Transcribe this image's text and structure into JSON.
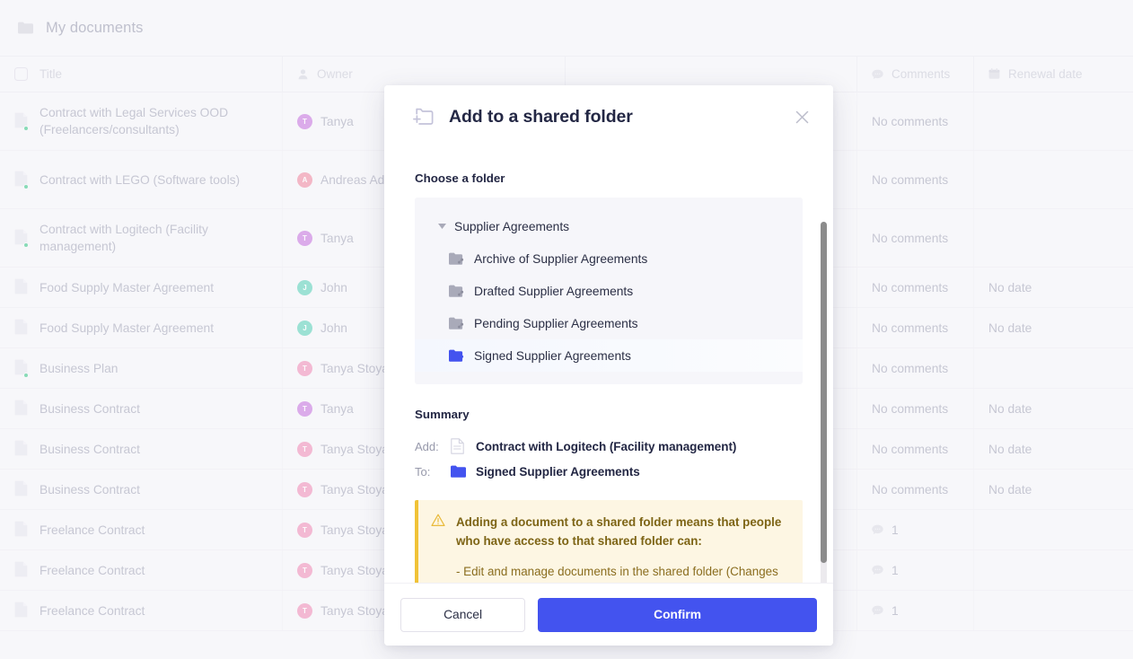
{
  "page": {
    "header": {
      "folder_icon": "folder-icon",
      "title": "My documents"
    },
    "table": {
      "columns": [
        {
          "key": "title",
          "label": "Title",
          "icon": "checkbox-icon"
        },
        {
          "key": "owner",
          "label": "Owner",
          "icon": "person-icon"
        },
        {
          "key": "mid",
          "label": "",
          "icon": ""
        },
        {
          "key": "comments",
          "label": "Comments",
          "icon": "comment-icon"
        },
        {
          "key": "renewal",
          "label": "Renewal date",
          "icon": "calendar-icon"
        }
      ],
      "rows": [
        {
          "title": "Contract with Legal Services OOD (Freelancers/consultants)",
          "status_dot": true,
          "owner": "Tanya",
          "owner_initial": "T",
          "owner_color": "#c879e0",
          "comments": "No comments",
          "comment_count": "",
          "renewal": ""
        },
        {
          "title": "Contract with LEGO (Software tools)",
          "status_dot": true,
          "owner": "Andreas Ad",
          "owner_initial": "A",
          "owner_color": "#f08da4",
          "comments": "No comments",
          "comment_count": "",
          "renewal": ""
        },
        {
          "title": "Contract with Logitech (Facility management)",
          "status_dot": true,
          "owner": "Tanya",
          "owner_initial": "T",
          "owner_color": "#c879e0",
          "comments": "No comments",
          "comment_count": "",
          "renewal": ""
        },
        {
          "title": "Food Supply Master Agreement",
          "status_dot": false,
          "owner": "John",
          "owner_initial": "J",
          "owner_color": "#5fd3bb",
          "comments": "No comments",
          "comment_count": "",
          "renewal": "No date"
        },
        {
          "title": "Food Supply Master Agreement",
          "status_dot": false,
          "owner": "John",
          "owner_initial": "J",
          "owner_color": "#5fd3bb",
          "comments": "No comments",
          "comment_count": "",
          "renewal": "No date"
        },
        {
          "title": "Business Plan",
          "status_dot": true,
          "owner": "Tanya Stoya",
          "owner_initial": "T",
          "owner_color": "#f08fb9",
          "comments": "No comments",
          "comment_count": "",
          "renewal": ""
        },
        {
          "title": "Business Contract",
          "status_dot": false,
          "owner": "Tanya",
          "owner_initial": "T",
          "owner_color": "#c879e0",
          "comments": "No comments",
          "comment_count": "",
          "renewal": "No date"
        },
        {
          "title": "Business Contract",
          "status_dot": false,
          "owner": "Tanya Stoya",
          "owner_initial": "T",
          "owner_color": "#f08fb9",
          "comments": "No comments",
          "comment_count": "",
          "renewal": "No date"
        },
        {
          "title": "Business Contract",
          "status_dot": false,
          "owner": "Tanya Stoya",
          "owner_initial": "T",
          "owner_color": "#f08fb9",
          "comments": "No comments",
          "comment_count": "",
          "renewal": "No date"
        },
        {
          "title": "Freelance Contract",
          "status_dot": false,
          "owner": "Tanya Stoya",
          "owner_initial": "T",
          "owner_color": "#f08fb9",
          "comments": "",
          "comment_count": "1",
          "renewal": ""
        },
        {
          "title": "Freelance Contract",
          "status_dot": false,
          "owner": "Tanya Stoya",
          "owner_initial": "T",
          "owner_color": "#f08fb9",
          "comments": "",
          "comment_count": "1",
          "renewal": ""
        },
        {
          "title": "Freelance Contract",
          "status_dot": false,
          "owner": "Tanya Stoya",
          "owner_initial": "T",
          "owner_color": "#f08fb9",
          "comments": "",
          "comment_count": "1",
          "renewal": ""
        }
      ]
    }
  },
  "modal": {
    "icon": "add-to-folder-icon",
    "title": "Add to a shared folder",
    "close_icon": "close-icon",
    "choose_label": "Choose a folder",
    "tree": [
      {
        "label": "Supplier Agreements",
        "level": 0,
        "expanded": true,
        "selected": false,
        "icon": "caret-down-icon"
      },
      {
        "label": "Archive of Supplier Agreements",
        "level": 1,
        "expanded": false,
        "selected": false,
        "icon": "shared-folder-icon"
      },
      {
        "label": "Drafted Supplier Agreements",
        "level": 1,
        "expanded": false,
        "selected": false,
        "icon": "shared-folder-icon"
      },
      {
        "label": "Pending Supplier Agreements",
        "level": 1,
        "expanded": false,
        "selected": false,
        "icon": "shared-folder-icon"
      },
      {
        "label": "Signed Supplier Agreements",
        "level": 1,
        "expanded": false,
        "selected": true,
        "icon": "shared-folder-icon"
      }
    ],
    "summary": {
      "label": "Summary",
      "add_key": "Add:",
      "add_value": "Contract with Logitech (Facility management)",
      "to_key": "To:",
      "to_value": "Signed Supplier Agreements"
    },
    "warning": {
      "icon": "warning-triangle-icon",
      "strong": "Adding a document to a shared folder means that people who have access to that shared folder can:",
      "body": "- Edit and manage documents in the shared folder (Changes"
    },
    "footer": {
      "cancel": "Cancel",
      "confirm": "Confirm"
    }
  },
  "colors": {
    "accent": "#4353ef",
    "selected_folder": "#4353ef",
    "warning_border": "#f0c237",
    "warning_bg": "#fdf6e3",
    "status_dot": "#3ec98a",
    "page_bg": "#f7f7fa"
  }
}
